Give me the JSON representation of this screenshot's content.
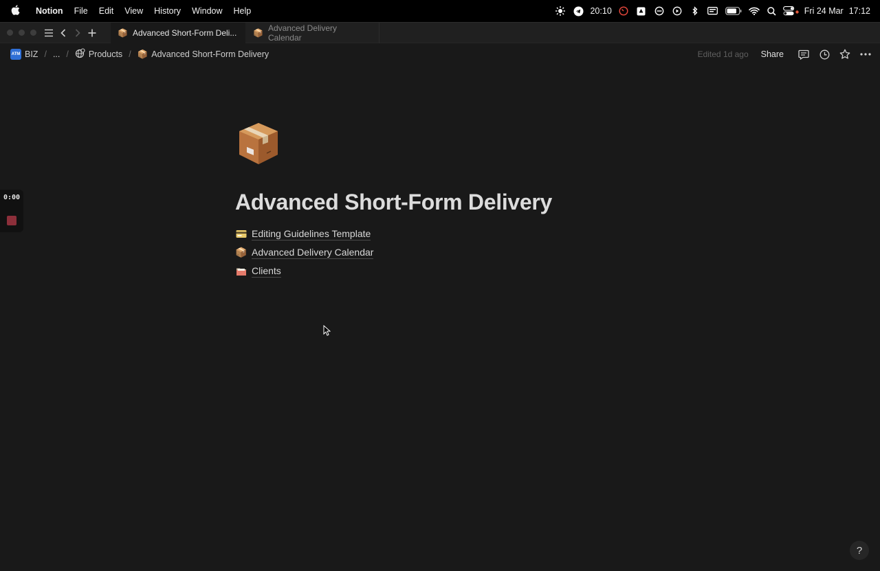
{
  "menubar": {
    "app": "Notion",
    "menus": [
      "File",
      "Edit",
      "View",
      "History",
      "Window",
      "Help"
    ],
    "timer": "20:10",
    "date": "Fri 24 Mar",
    "time": "17:12"
  },
  "tabs": [
    {
      "label": "Advanced Short-Form Deli...",
      "icon": "package-emoji-icon",
      "active": true
    },
    {
      "label": "Advanced Delivery Calendar",
      "icon": "package-emoji-icon",
      "active": false
    }
  ],
  "breadcrumb": {
    "workspace_badge": "ATM",
    "workspace": "BIZ",
    "ellipsis": "...",
    "parent": "Products",
    "current": "Advanced Short-Form Delivery"
  },
  "topbar": {
    "edited": "Edited 1d ago",
    "share": "Share"
  },
  "page": {
    "title": "Advanced Short-Form Delivery",
    "links": [
      {
        "label": "Editing Guidelines Template",
        "icon": "card-emoji-icon"
      },
      {
        "label": "Advanced Delivery Calendar",
        "icon": "package-emoji-icon"
      },
      {
        "label": "Clients",
        "icon": "folder-emoji-icon"
      }
    ]
  },
  "recording": {
    "elapsed": "0:00"
  },
  "help": "?",
  "colors": {
    "background": "#191919",
    "tabbar": "#202020",
    "workspace_badge": "#2f6fd6",
    "stop_button": "#8c2f3a"
  }
}
